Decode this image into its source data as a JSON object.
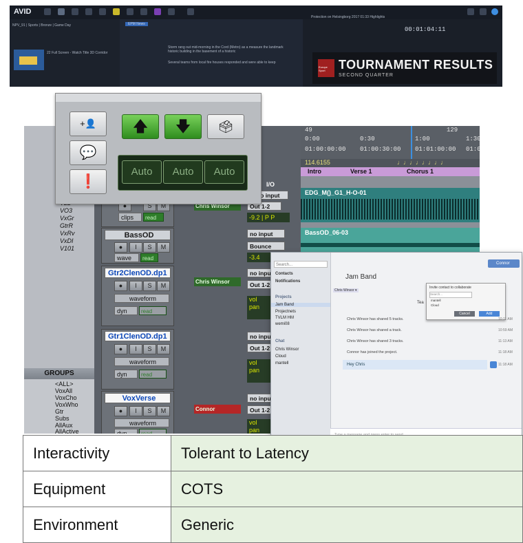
{
  "editor": {
    "brand": "AVID",
    "timecode": "00:01:04:11",
    "tab_media": "EPM News",
    "breadcrumb": "NPV_91 | Sports | Bronze | Game Day",
    "clip_title": "22 Full Screen - Watch Title 3D Corridor",
    "script_text_1": "Storm rang out mid-morning in the Cord (Metro) as a measure the landmark historic building in the basement of a historic",
    "script_text_2": "Several teams from local fire houses responded and were able to keep",
    "playback_title": "Protection on Helsingborg 2017 01:33 Highlights",
    "tournament_title": "TOURNAMENT RESULTS",
    "tournament_sub": "SECOND QUARTER",
    "logo_text": "Europe Sport"
  },
  "control_panel": {
    "add_user_icon": "+👤",
    "auto_labels": [
      "Auto",
      "Auto",
      "Auto"
    ],
    "up_arrow": "🡅",
    "down_arrow": "🡇"
  },
  "tracklist": {
    "items": [
      "V22",
      "VO3",
      "VxGr",
      "GtrR",
      "VxRv",
      "VxDI",
      "V101"
    ]
  },
  "groups": {
    "header": "GROUPS",
    "items": [
      "<ALL>",
      "VoxAll",
      "VoxCho",
      "VoxWho",
      "Gtr",
      "Subs",
      "AllAux",
      "AllActive"
    ]
  },
  "mixer": {
    "channels": [
      {
        "name": "BassOD",
        "view": "wave",
        "mode": "read",
        "user": "",
        "input": "no input",
        "output": "Bounce",
        "value": "-3.4"
      },
      {
        "name": "Gtr2ClenOD.dp1",
        "view": "waveform",
        "mode": "dyn",
        "read": "read",
        "user": "Chris Winsor",
        "input": "no input",
        "output": "Out 1-2",
        "vol": "vol",
        "pan": "pan"
      },
      {
        "name": "Gtr1ClenOD.dp1",
        "view": "waveform",
        "mode": "dyn",
        "read": "read",
        "user": "",
        "input": "no input",
        "output": "Out 1-2",
        "vol": "vol",
        "pan": "pan"
      },
      {
        "name": "VoxVerse",
        "view": "waveform",
        "mode": "dyn",
        "read": "read",
        "user": "Connor",
        "input": "no input",
        "output": "Out 1-2",
        "vol": "vol",
        "pan": "pan"
      }
    ],
    "top_channel": {
      "user": "Chris Winsor",
      "output": "Out 1-2",
      "value": "-9.2",
      "p1": "P",
      "p2": "P",
      "clips": "clips",
      "read": "read",
      "io": "I/O",
      "input": "no input"
    },
    "solo": "S",
    "mute": "M"
  },
  "edit": {
    "ruler_top": [
      "0:00",
      "0:30",
      "1:00",
      "1:30"
    ],
    "ruler_tc": [
      "01:00:00:00",
      "01:00:30:00",
      "01:01:00:00",
      "01:0"
    ],
    "tempo": "114.6155",
    "bar_ticks": [
      "49",
      "129"
    ],
    "markers": [
      "Intro",
      "Verse 1",
      "Chorus 1"
    ],
    "clip1": "EDG_M()_G1_H-O-01",
    "clip2": "BassOD_06-03"
  },
  "chat": {
    "search_placeholder": "Search...",
    "user_button": "Connor",
    "contacts": "Contacts",
    "notifications": "Notifications",
    "projects_header": "Projects",
    "projects": [
      "Jam Band",
      "Projectnets",
      "TVLM HM",
      "wemi08"
    ],
    "chat_header": "Chat",
    "chat_users": [
      "Chris Winsor",
      "Cloud",
      "mantell"
    ],
    "title": "Jam Band",
    "filter": "Chris Winsor ▾",
    "team_label": "Tea",
    "invite_title": "Invite contact to collaborate",
    "invite_search": "Search...",
    "invite_items": [
      "mantell",
      "Cloud"
    ],
    "cancel": "Cancel",
    "add": "Add",
    "messages": [
      {
        "text": "Chris Winsor has shared 5 tracks.",
        "time": "10:11 AM"
      },
      {
        "text": "Chris Winsor has shared a track.",
        "time": "10:59 AM"
      },
      {
        "text": "Chris Winsor has shared 3 tracks.",
        "time": "11:13 AM"
      },
      {
        "text": "Connor has joined the project.",
        "time": "11:18 AM"
      }
    ],
    "reply": "Hey Chris",
    "reply_time": "11:18 AM",
    "input_placeholder": "Type a message and press enter to send..."
  },
  "table": {
    "rows": [
      {
        "label": "Interactivity",
        "value": "Tolerant to Latency"
      },
      {
        "label": "Equipment",
        "value": "COTS"
      },
      {
        "label": "Environment",
        "value": "Generic"
      }
    ]
  },
  "colors": {
    "editor_bg": "#232a36",
    "protools_green": "#2e7d2a",
    "table_value_bg": "#e6f1e0",
    "chat_accent": "#5b87c9"
  }
}
